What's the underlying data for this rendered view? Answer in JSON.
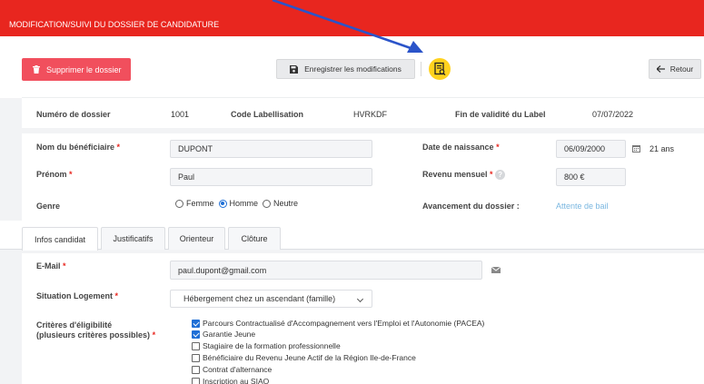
{
  "header": {
    "title": "MODIFICATION/SUIVI DU DOSSIER DE CANDIDATURE"
  },
  "toolbar": {
    "delete_label": "Supprimer le dossier",
    "save_label": "Enregistrer les modifications",
    "back_label": "Retour"
  },
  "dossier": {
    "numero_label": "Numéro de dossier",
    "numero_value": "1001",
    "code_label": "Code Labellisation",
    "code_value": "HVRKDF",
    "fin_label": "Fin de validité du Label",
    "fin_value": "07/07/2022"
  },
  "beneficiaire": {
    "nom_label": "Nom du bénéficiaire",
    "nom_value": "DUPONT",
    "prenom_label": "Prénom",
    "prenom_value": "Paul",
    "genre_label": "Genre",
    "genre_options": [
      "Femme",
      "Homme",
      "Neutre"
    ],
    "genre_selected": "Homme",
    "naissance_label": "Date de naissance",
    "naissance_value": "06/09/2000",
    "age": "21 ans",
    "revenu_label": "Revenu mensuel",
    "revenu_value": "800 €",
    "avancement_label": "Avancement du dossier :",
    "avancement_value": "Attente de bail"
  },
  "tabs": [
    {
      "label": "Infos candidat",
      "active": true
    },
    {
      "label": "Justificatifs",
      "active": false
    },
    {
      "label": "Orienteur",
      "active": false
    },
    {
      "label": "Clôture",
      "active": false
    }
  ],
  "form": {
    "email_label": "E-Mail",
    "email_value": "paul.dupont@gmail.com",
    "logement_label": "Situation Logement",
    "logement_value": "Hébergement chez un ascendant (famille)",
    "criteres_label_1": "Critères d'éligibilité",
    "criteres_label_2": "(plusieurs critères possibles)",
    "criteres": [
      {
        "label": "Parcours Contractualisé d'Accompagnement vers l'Emploi et l'Autonomie (PACEA)",
        "checked": true
      },
      {
        "label": "Garantie Jeune",
        "checked": true
      },
      {
        "label": "Stagiaire de la formation professionnelle",
        "checked": false
      },
      {
        "label": "Bénéficiaire du Revenu Jeune Actif de la Région Ile-de-France",
        "checked": false
      },
      {
        "label": "Contrat d'alternance",
        "checked": false
      },
      {
        "label": "Inscription au SIAO",
        "checked": false
      }
    ]
  },
  "colors": {
    "header_red": "#e8261f",
    "delete_red": "#f14f5d",
    "checkbox_blue": "#1f6fd6",
    "arrow_blue": "#2b54c9",
    "status_blue": "#7ab7e0",
    "doc_icon_yellow": "#ffd21f"
  },
  "icons": {
    "delete": "trash-icon",
    "save": "floppy-disk-icon",
    "doc": "document-search-icon",
    "back": "arrow-left-icon",
    "calendar": "calendar-icon",
    "mail": "envelope-icon",
    "help": "question-circle-icon"
  }
}
